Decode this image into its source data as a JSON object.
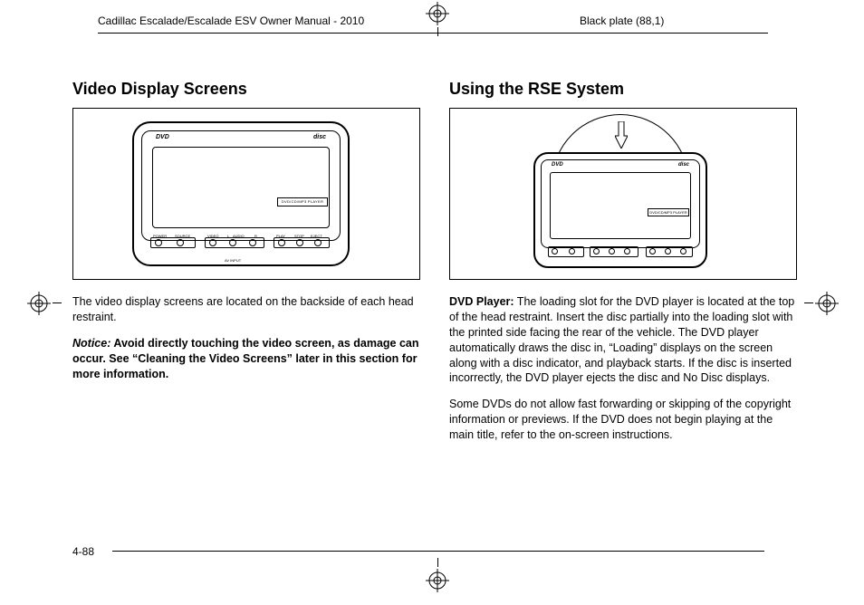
{
  "header": {
    "left": "Cadillac Escalade/Escalade ESV Owner Manual - 2010",
    "right": "Black plate (88,1)"
  },
  "left_col": {
    "heading": "Video Display Screens",
    "figure": {
      "player_label": "DVD/CD/MP3 PLAYER",
      "logo_left": "DVD",
      "logo_right": "disc",
      "ctrl_labels": {
        "power": "POWER",
        "source": "SOURCE",
        "video": "VIDEO",
        "l": "L",
        "audio": "AUDIO",
        "r": "R",
        "play": "PLAY",
        "stop": "STOP",
        "eject": "EJECT",
        "av_input": "AV INPUT"
      }
    },
    "p1": "The video display screens are located on the backside of each head restraint.",
    "notice_label": "Notice:",
    "notice_body": " Avoid directly touching the video screen, as damage can occur. See “Cleaning the Video Screens” later in this section for more information."
  },
  "right_col": {
    "heading": "Using the RSE System",
    "figure": {
      "player_label": "DVD/CD/MP3 PLAYER",
      "logo_left": "DVD",
      "logo_right": "disc"
    },
    "runin_label": "DVD Player:",
    "p1_body": " The loading slot for the DVD player is located at the top of the head restraint. Insert the disc partially into the loading slot with the printed side facing the rear of the vehicle. The DVD player automatically draws the disc in, “Loading” displays on the screen along with a disc indicator, and playback starts. If the disc is inserted incorrectly, the DVD player ejects the disc and No Disc displays.",
    "p2": "Some DVDs do not allow fast forwarding or skipping of the copyright information or previews. If the DVD does not begin playing at the main title, refer to the on-screen instructions."
  },
  "page_number": "4-88"
}
